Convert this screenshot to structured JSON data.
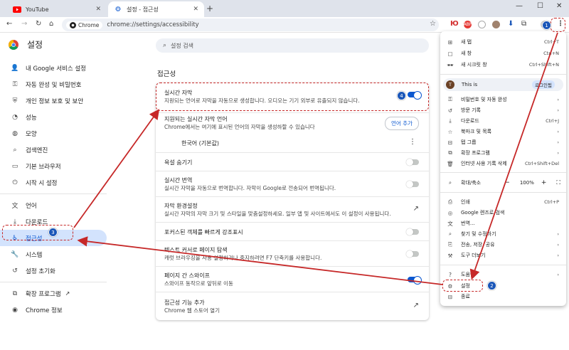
{
  "tabs": [
    {
      "title": "YouTube"
    },
    {
      "title": "설정 - 접근성"
    }
  ],
  "toolbar": {
    "chip": "Chrome",
    "url": "chrome://settings/accessibility",
    "ext_text": "Ю",
    "ext_badge": "ABP"
  },
  "nav": {
    "title": "설정",
    "items": [
      {
        "label": "내 Google 서비스 설정",
        "icon": "person-icon"
      },
      {
        "label": "자동 완성 및 비밀번호",
        "icon": "key-icon"
      },
      {
        "label": "개인 정보 보호 및 보안",
        "icon": "shield-icon"
      },
      {
        "label": "성능",
        "icon": "speed-icon"
      },
      {
        "label": "모양",
        "icon": "palette-icon"
      },
      {
        "label": "검색엔진",
        "icon": "search-icon"
      },
      {
        "label": "기본 브라우저",
        "icon": "browser-icon"
      },
      {
        "label": "시작 시 설정",
        "icon": "power-icon"
      },
      {
        "label": "언어",
        "icon": "language-icon"
      },
      {
        "label": "다운로드",
        "icon": "download-icon"
      },
      {
        "label": "접근성",
        "icon": "accessibility-icon"
      },
      {
        "label": "시스템",
        "icon": "wrench-icon"
      },
      {
        "label": "설정 초기화",
        "icon": "reset-icon"
      },
      {
        "label": "확장 프로그램",
        "icon": "puzzle-icon"
      },
      {
        "label": "Chrome 정보",
        "icon": "chrome-icon"
      }
    ]
  },
  "search": {
    "placeholder": "설정 검색"
  },
  "section": {
    "title": "접근성"
  },
  "settings": {
    "live_caption": {
      "title": "실시간 자막",
      "desc": "지원되는 언어로 자막을 자동으로 생성합니다. 오디오는 기기 외부로 유출되지 않습니다."
    },
    "languages": {
      "title": "지원되는 실시간 자막 언어",
      "desc": "Chrome에서는 여기에 표시된 언어의 자막을 생성하할 수 있습니다",
      "button": "언어 추가",
      "language": "한국어 (기본값)"
    },
    "profanity": {
      "title": "욕설 숨기기"
    },
    "translate": {
      "title": "실시간 번역",
      "desc": "실시간 자막을 자동으로 번역합니다. 자막이 Google로 전송되어 번역됩니다."
    },
    "caption_prefs": {
      "title": "자막 환경설정",
      "desc": "실시간 자막의 자막 크기 및 스타일을 맞춤설정하세요. 일부 앱 및 사이트에서도 이 설정이 사용됩니다."
    },
    "focus": {
      "title": "포커스된 객체를 빠르게 강조표시"
    },
    "caret": {
      "title": "텍스트 커서로 페이지 탐색",
      "desc": "캐럿 브라우징을 사용 설정하거나 중지하려면 F7 단축키를 사용합니다."
    },
    "swipe": {
      "title": "페이지 간 스와이프",
      "desc": "스와이프 동작으로 앞뒤로 이동"
    },
    "add_features": {
      "title": "접근성 기능 추가",
      "desc": "Chrome 웹 스토어 열기"
    }
  },
  "menu": {
    "items": {
      "new_tab": {
        "label": "새 탭",
        "shortcut": "Ctrl+T"
      },
      "new_window": {
        "label": "새 창",
        "shortcut": "Ctrl+N"
      },
      "incognito": {
        "label": "새 시크릿 창",
        "shortcut": "Ctrl+Shift+N"
      },
      "profile": {
        "label": "This is",
        "badge": "로그인됨",
        "avatar": "T"
      },
      "passwords": {
        "label": "비밀번호 및 자동 완성"
      },
      "history": {
        "label": "방문 기록"
      },
      "downloads": {
        "label": "다운로드",
        "shortcut": "Ctrl+J"
      },
      "bookmarks": {
        "label": "북마크 및 목록"
      },
      "tab_groups": {
        "label": "탭 그룹"
      },
      "extensions": {
        "label": "확장 프로그램"
      },
      "clear_data": {
        "label": "인터넷 사용 기록 삭제",
        "shortcut": "Ctrl+Shift+Del"
      },
      "zoom": {
        "label": "확대/축소",
        "minus": "−",
        "value": "100%",
        "plus": "+"
      },
      "print": {
        "label": "인쇄",
        "shortcut": "Ctrl+P"
      },
      "lens": {
        "label": "Google 렌즈로 검색"
      },
      "translate": {
        "label": "번역..."
      },
      "find": {
        "label": "찾기 및 수정하기"
      },
      "cast": {
        "label": "전송, 저장, 공유"
      },
      "more_tools": {
        "label": "도구 더보기"
      },
      "help": {
        "label": "도움말"
      },
      "settings": {
        "label": "설정"
      },
      "exit": {
        "label": "종료"
      }
    }
  },
  "annotations": {
    "n1": "1",
    "n2": "2",
    "n3": "3",
    "n4": "4"
  },
  "colors": {
    "accent": "#0b57d0",
    "annotation": "#c62828",
    "badge": "#1a56b8"
  }
}
